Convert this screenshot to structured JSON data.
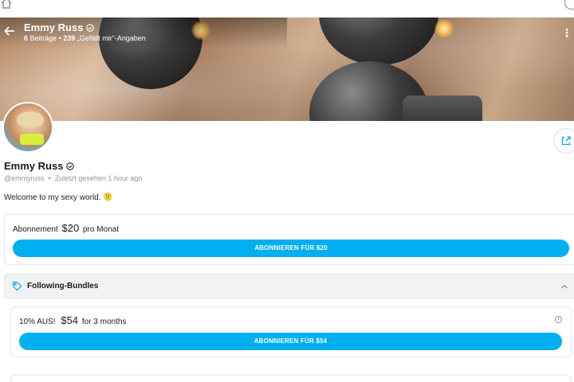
{
  "cover": {
    "name": "Emmy Russ",
    "posts_count": "6",
    "posts_label": "Beiträge",
    "likes_count": "239",
    "likes_label": "„Gefällt mir“-Angaben"
  },
  "profile": {
    "name": "Emmy Russ",
    "username": "@emmyruss",
    "last_seen": "Zuletzt gesehen 1 hour ago",
    "bio": "Welcome to my sexy world. 🫠"
  },
  "subscription": {
    "label": "Abonnement",
    "price": "$20",
    "period": "pro Monat",
    "button": "ABONNIEREN FÜR $20"
  },
  "bundles": {
    "title": "Following-Bundles",
    "items": [
      {
        "discount": "10% AUS!",
        "price": "$54",
        "duration": "for 3 months",
        "button": "ABONNIEREN FÜR $54"
      }
    ]
  },
  "colors": {
    "accent": "#00aff0",
    "muted_text": "#8a96a3",
    "section_bg": "#f1f2f4"
  },
  "icons": [
    "home-icon",
    "back-arrow-icon",
    "verified-icon",
    "more-vertical-icon",
    "share-icon",
    "tag-icon",
    "chevron-up-icon",
    "info-icon"
  ]
}
